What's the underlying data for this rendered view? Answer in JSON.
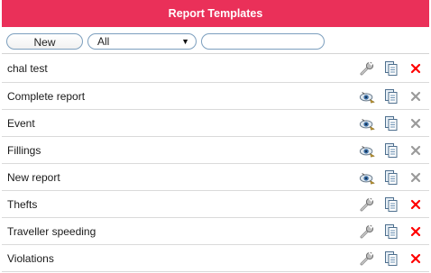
{
  "panel": {
    "title": "Report Templates"
  },
  "toolbar": {
    "new_label": "New",
    "filter_selected": "All",
    "filter_arrow": "▼",
    "search_value": "",
    "search_placeholder": ""
  },
  "templates": [
    {
      "name": "chal test",
      "mode": "edit",
      "delete_enabled": true
    },
    {
      "name": "Complete report",
      "mode": "view",
      "delete_enabled": false
    },
    {
      "name": "Event",
      "mode": "view",
      "delete_enabled": false
    },
    {
      "name": "Fillings",
      "mode": "view",
      "delete_enabled": false
    },
    {
      "name": "New report",
      "mode": "view",
      "delete_enabled": false
    },
    {
      "name": "Thefts",
      "mode": "edit",
      "delete_enabled": true
    },
    {
      "name": "Traveller speeding",
      "mode": "edit",
      "delete_enabled": true
    },
    {
      "name": "Violations",
      "mode": "edit",
      "delete_enabled": true
    }
  ],
  "icons": {
    "edit": "wrench-icon",
    "view": "eye-icon",
    "copy": "copy-icon",
    "delete": "delete-icon"
  },
  "colors": {
    "header_bg": "#ea3059",
    "header_text": "#ffffff",
    "delete_active": "#ff0000",
    "delete_inactive": "#9a9a9a",
    "control_border": "#7c9fbe"
  }
}
